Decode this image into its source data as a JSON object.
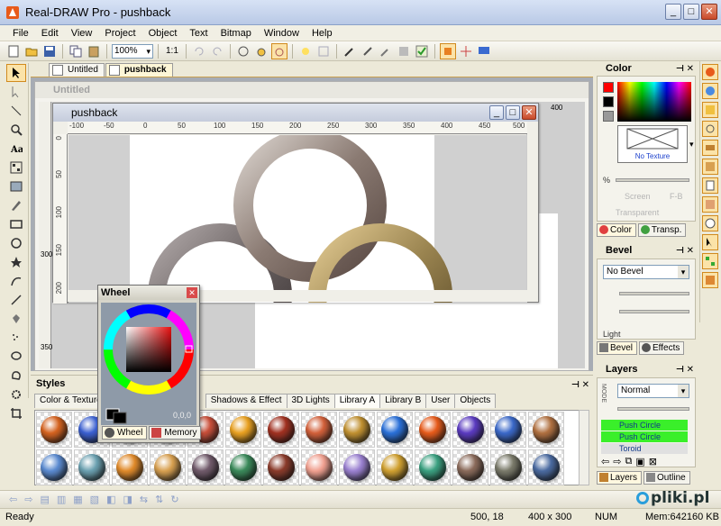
{
  "window": {
    "title": "Real-DRAW Pro - pushback"
  },
  "menu": [
    "File",
    "Edit",
    "View",
    "Project",
    "Object",
    "Text",
    "Bitmap",
    "Window",
    "Help"
  ],
  "toolbar": {
    "zoom_value": "100%",
    "ratio_label": "1:1"
  },
  "doc_tabs": [
    {
      "label": "Untitled"
    },
    {
      "label": "pushback"
    }
  ],
  "untitled_window": {
    "title": "Untitled"
  },
  "pushback_window": {
    "title": "pushback"
  },
  "ruler_h": [
    "-100",
    "-50",
    "0",
    "50",
    "100",
    "150",
    "200",
    "250",
    "300",
    "350",
    "400",
    "450",
    "500"
  ],
  "ruler_v": [
    "0",
    "50",
    "100",
    "150",
    "200"
  ],
  "untitled_ruler_label": "400",
  "untitled_ruler_v": [
    "300",
    "350"
  ],
  "wheel_panel": {
    "title": "Wheel",
    "coords": "0,0,0",
    "tabs": [
      "Wheel",
      "Memory"
    ]
  },
  "styles_panel": {
    "title": "Styles",
    "tabs": [
      "Color & Texture",
      "Shadows & Effect",
      "3D Lights",
      "Library A",
      "Library B",
      "User",
      "Objects"
    ],
    "swatch_colors": [
      "#d4621f",
      "#3a5fd0",
      "#d84f8a",
      "#2aa84a",
      "#c94f3a",
      "#e8a020",
      "#a03020",
      "#d2603a",
      "#c09030",
      "#2a70d8",
      "#e65a1a",
      "#5a3ac0",
      "#3a68c8",
      "#b07040",
      "#5a8ad0",
      "#6aa0b0",
      "#e08a2a",
      "#d8a050",
      "#705a6a",
      "#3a8a5a",
      "#8a3a2a",
      "#f0a090",
      "#9a80d0",
      "#d0a030",
      "#3aa080",
      "#8a6a5a",
      "#7a7a6a",
      "#4a6aa0"
    ]
  },
  "color_panel": {
    "title": "Color",
    "texture_label": "No Texture",
    "percent_label": "%",
    "screen_label": "Screen",
    "fb_label": "F-B",
    "transparency_label": "Transparent",
    "tabs": [
      "Color",
      "Transp."
    ]
  },
  "bevel_panel": {
    "title": "Bevel",
    "select_value": "No Bevel",
    "light_label": "Light",
    "tabs": [
      "Bevel",
      "Effects"
    ]
  },
  "layers_panel": {
    "title": "Layers",
    "mode_label": "MODE",
    "mode_value": "Normal",
    "layers": [
      {
        "name": "Push Circle"
      },
      {
        "name": "Push Circle"
      },
      {
        "name": "Toroid"
      }
    ],
    "tabs": [
      "Layers",
      "Outline"
    ]
  },
  "status": {
    "ready": "Ready",
    "coords": "500, 18",
    "size": "400 x 300",
    "num": "NUM",
    "mem": "Mem:642160 KB"
  },
  "logo": {
    "text": "pliki.pl"
  }
}
